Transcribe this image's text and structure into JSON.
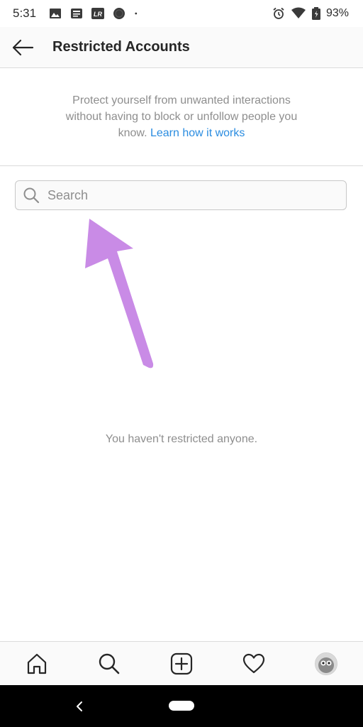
{
  "status_bar": {
    "time": "5:31",
    "battery": "93%",
    "notification_icons": [
      "image-icon",
      "news-icon",
      "lightroom-icon",
      "badge-icon",
      "dot-icon"
    ],
    "system_icons": [
      "alarm-icon",
      "wifi-icon",
      "battery-icon"
    ]
  },
  "header": {
    "title": "Restricted Accounts",
    "back_icon": "arrow-left-icon"
  },
  "intro": {
    "text": "Protect yourself from unwanted interactions without having to block or unfollow people you know.",
    "link": "Learn how it works",
    "link_color": "#2a8ce0"
  },
  "search": {
    "placeholder": "Search",
    "value": ""
  },
  "annotation": {
    "color": "#c98be6"
  },
  "empty_state": {
    "text": "You haven't restricted anyone."
  },
  "tab_bar": {
    "tabs": [
      "home-icon",
      "search-icon",
      "add-post-icon",
      "heart-icon",
      "profile-avatar"
    ]
  },
  "colors": {
    "text_primary": "#262626",
    "text_secondary": "#8e8e8e",
    "divider": "#dbdbdb"
  }
}
